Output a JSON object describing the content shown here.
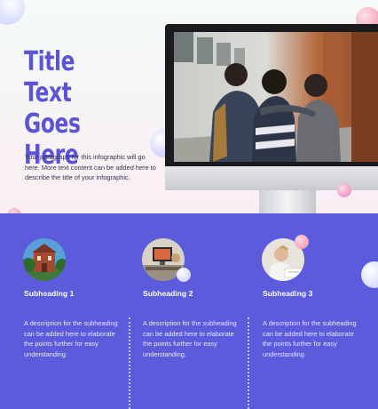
{
  "hero": {
    "title_line1": "Title Text",
    "title_line2": "Goes Here",
    "paragraph": "Your paragraph for this infographic will go here. More text content can be added here to describe the title of your infographic."
  },
  "monitor": {
    "image_description_icon": "students-photo"
  },
  "columns": [
    {
      "subheading": "Subheading 1",
      "description": "A description for the subheading can be added here to elaborate the points further for easy understanding.",
      "image_icon": "school-building-photo"
    },
    {
      "subheading": "Subheading 2",
      "description": "A description for the subheading can be added here to elaborate the points further for easy understanding.",
      "image_icon": "classroom-computer-photo"
    },
    {
      "subheading": "Subheading 3",
      "description": "A description for the subheading can be added here to elaborate the points further for easy understanding.",
      "image_icon": "student-writing-photo"
    }
  ],
  "colors": {
    "title": "#5b55d6",
    "band": "#5b5bdb",
    "subheading": "#ffffff"
  }
}
